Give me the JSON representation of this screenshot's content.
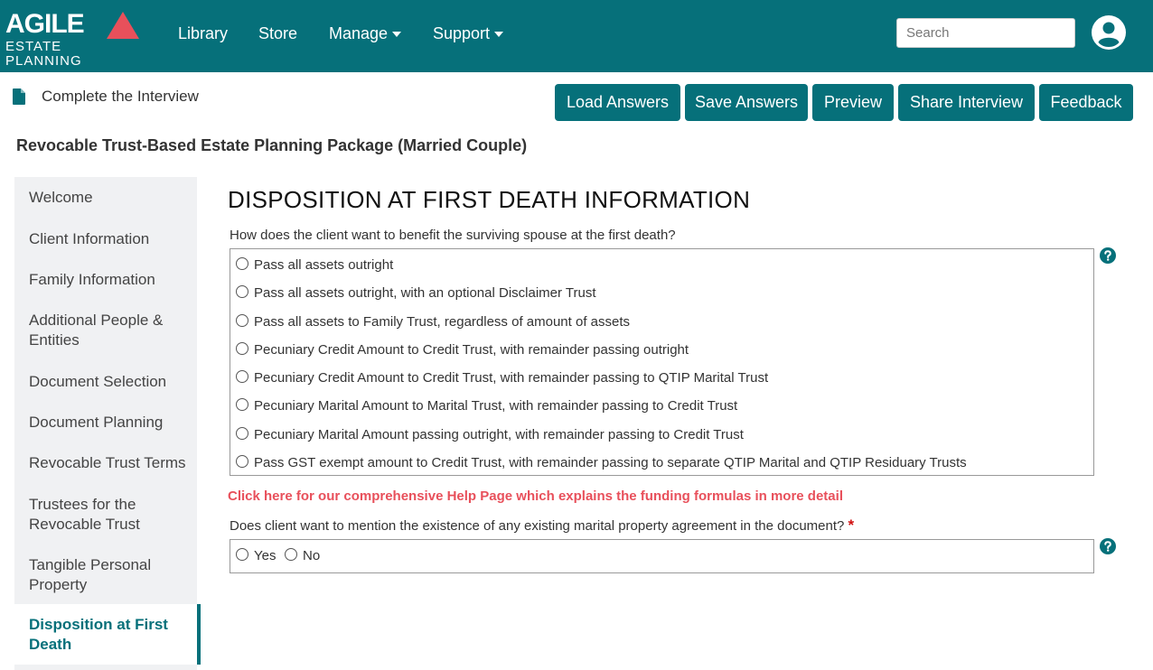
{
  "brand": {
    "name_main": "AGILE",
    "name_sub": "ESTATE PLANNING",
    "accent": "#e8505b"
  },
  "colors": {
    "primary": "#06707a",
    "link": "#e8505b",
    "required": "#d01010"
  },
  "nav": {
    "items": [
      {
        "label": "Library",
        "dropdown": false
      },
      {
        "label": "Store",
        "dropdown": false
      },
      {
        "label": "Manage",
        "dropdown": true
      },
      {
        "label": "Support",
        "dropdown": true
      }
    ],
    "search_placeholder": "Search",
    "avatar_icon": "user-circle-icon"
  },
  "toolbar": {
    "heading": "Complete the Interview",
    "heading_icon": "file-icon",
    "buttons": [
      "Load Answers",
      "Save Answers",
      "Preview",
      "Share Interview",
      "Feedback"
    ]
  },
  "package_title": "Revocable Trust-Based Estate Planning Package (Married Couple)",
  "sidebar": {
    "items": [
      "Welcome",
      "Client Information",
      "Family Information",
      "Additional People & Entities",
      "Document Selection",
      "Document Planning",
      "Revocable Trust Terms",
      "Trustees for the Revocable Trust",
      "Tangible Personal Property"
    ],
    "active": "Disposition at First Death"
  },
  "main": {
    "title": "DISPOSITION AT FIRST DEATH INFORMATION",
    "q1": {
      "text": "How does the client want to benefit the surviving spouse at the first death?",
      "options": [
        "Pass all assets outright",
        "Pass all assets outright, with an optional Disclaimer Trust",
        "Pass all assets to Family Trust, regardless of amount of assets",
        "Pecuniary Credit Amount to Credit Trust, with remainder passing outright",
        "Pecuniary Credit Amount to Credit Trust, with remainder passing to QTIP Marital Trust",
        "Pecuniary Marital Amount to Marital Trust, with remainder passing to Credit Trust",
        "Pecuniary Marital Amount passing outright, with remainder passing to Credit Trust",
        "Pass GST exempt amount to Credit Trust, with remainder passing to separate QTIP Marital and QTIP Residuary Trusts"
      ],
      "help_icon": "question-circle-icon"
    },
    "help_link": "Click here for our comprehensive Help Page which explains the funding formulas in more detail",
    "q2": {
      "text": "Does client want to mention the existence of any existing marital property agreement in the document?",
      "required_mark": "*",
      "options": [
        "Yes",
        "No"
      ],
      "help_icon": "question-circle-icon"
    }
  }
}
